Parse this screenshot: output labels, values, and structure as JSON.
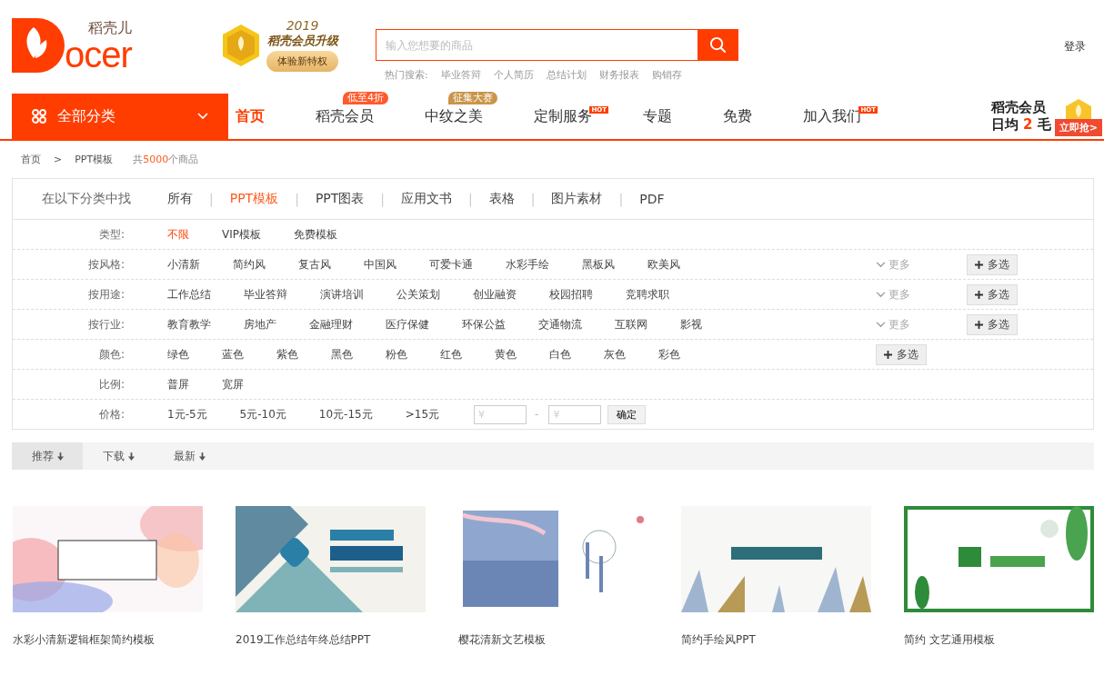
{
  "header": {
    "logo": {
      "name": "稻壳儿",
      "wordmark": "ocer"
    },
    "promo": {
      "year": "2019",
      "title": "稻壳会员升级",
      "button": "体验新特权"
    },
    "search": {
      "placeholder": "输入您想要的商品"
    },
    "hot_label": "热门搜索:",
    "hot_searches": [
      "毕业答辩",
      "个人简历",
      "总结计划",
      "财务报表",
      "购销存"
    ],
    "login": "登录"
  },
  "nav": {
    "category_button": "全部分类",
    "items": [
      {
        "label": "首页",
        "selected": true
      },
      {
        "label": "稻壳会员",
        "selected": false,
        "badge": {
          "kind": "tag",
          "text": "低至4折",
          "color": "#ff5a2c"
        }
      },
      {
        "label": "中纹之美",
        "selected": false,
        "badge": {
          "kind": "tag",
          "text": "征集大赛",
          "color": "#c9954a"
        }
      },
      {
        "label": "定制服务",
        "selected": false,
        "badge": {
          "kind": "hot",
          "text": "HOT",
          "color": "#ff3d00"
        }
      },
      {
        "label": "专题",
        "selected": false
      },
      {
        "label": "免费",
        "selected": false
      },
      {
        "label": "加入我们",
        "selected": false,
        "badge": {
          "kind": "hot",
          "text": "HOT",
          "color": "#ff3d00"
        }
      }
    ],
    "vip": {
      "line1": "稻壳会员",
      "line2_pre": "日均",
      "line2_num": "2",
      "line2_post": "毛",
      "button": "立即抢>"
    }
  },
  "breadcrumb": {
    "items": [
      "首页",
      "PPT模板"
    ],
    "separator": ">",
    "count_pre": "共",
    "count": "5000",
    "count_post": "个商品"
  },
  "filter": {
    "tabs_label": "在以下分类中找",
    "separator": "|",
    "tabs": [
      {
        "label": "所有",
        "selected": false
      },
      {
        "label": "PPT模板",
        "selected": true
      },
      {
        "label": "PPT图表",
        "selected": false
      },
      {
        "label": "应用文书",
        "selected": false
      },
      {
        "label": "表格",
        "selected": false
      },
      {
        "label": "图片素材",
        "selected": false
      },
      {
        "label": "PDF",
        "selected": false
      }
    ],
    "rows": [
      {
        "kind": "options",
        "label": "类型:",
        "options": [
          {
            "label": "不限",
            "selected": true
          },
          {
            "label": "VIP模板",
            "selected": false
          },
          {
            "label": "免费模板",
            "selected": false
          }
        ]
      },
      {
        "kind": "options",
        "label": "按风格:",
        "options": [
          {
            "label": "小清新",
            "selected": false
          },
          {
            "label": "简约风",
            "selected": false
          },
          {
            "label": "复古风",
            "selected": false
          },
          {
            "label": "中国风",
            "selected": false
          },
          {
            "label": "可爱卡通",
            "selected": false
          },
          {
            "label": "水彩手绘",
            "selected": false
          },
          {
            "label": "黑板风",
            "selected": false
          },
          {
            "label": "欧美风",
            "selected": false
          }
        ],
        "more": "更多",
        "multi": "多选"
      },
      {
        "kind": "options",
        "label": "按用途:",
        "options": [
          {
            "label": "工作总结",
            "selected": false
          },
          {
            "label": "毕业答辩",
            "selected": false
          },
          {
            "label": "演讲培训",
            "selected": false
          },
          {
            "label": "公关策划",
            "selected": false
          },
          {
            "label": "创业融资",
            "selected": false
          },
          {
            "label": "校园招聘",
            "selected": false
          },
          {
            "label": "竞聘求职",
            "selected": false
          }
        ],
        "more": "更多",
        "multi": "多选"
      },
      {
        "kind": "options",
        "label": "按行业:",
        "options": [
          {
            "label": "教育教学",
            "selected": false
          },
          {
            "label": "房地产",
            "selected": false
          },
          {
            "label": "金融理财",
            "selected": false
          },
          {
            "label": "医疗保健",
            "selected": false
          },
          {
            "label": "环保公益",
            "selected": false
          },
          {
            "label": "交通物流",
            "selected": false
          },
          {
            "label": "互联网",
            "selected": false
          },
          {
            "label": "影视",
            "selected": false
          }
        ],
        "more": "更多",
        "multi": "多选"
      },
      {
        "kind": "options",
        "label": "颜色:",
        "options": [
          {
            "label": "绿色",
            "selected": false
          },
          {
            "label": "蓝色",
            "selected": false
          },
          {
            "label": "紫色",
            "selected": false
          },
          {
            "label": "黑色",
            "selected": false
          },
          {
            "label": "粉色",
            "selected": false
          },
          {
            "label": "红色",
            "selected": false
          },
          {
            "label": "黄色",
            "selected": false
          },
          {
            "label": "白色",
            "selected": false
          },
          {
            "label": "灰色",
            "selected": false
          },
          {
            "label": "彩色",
            "selected": false
          }
        ],
        "multi": "多选"
      },
      {
        "kind": "options",
        "label": "比例:",
        "options": [
          {
            "label": "普屏",
            "selected": false
          },
          {
            "label": "宽屏",
            "selected": false
          }
        ]
      },
      {
        "kind": "price",
        "label": "价格:",
        "options": [
          {
            "label": "1元-5元",
            "selected": false
          },
          {
            "label": "5元-10元",
            "selected": false
          },
          {
            "label": "10元-15元",
            "selected": false
          },
          {
            "label": ">15元",
            "selected": false
          }
        ],
        "min_placeholder": "¥",
        "dash": "-",
        "max_placeholder": "¥",
        "confirm": "确定"
      }
    ]
  },
  "sort": [
    {
      "label": "推荐",
      "selected": true
    },
    {
      "label": "下载",
      "selected": false
    },
    {
      "label": "最新",
      "selected": false
    }
  ],
  "products": [
    {
      "title": "水彩小清新逻辑框架简约模板"
    },
    {
      "title": "2019工作总结年终总结PPT"
    },
    {
      "title": "樱花清新文艺模板"
    },
    {
      "title": "简约手绘风PPT"
    },
    {
      "title": "简约 文艺通用模板"
    }
  ]
}
